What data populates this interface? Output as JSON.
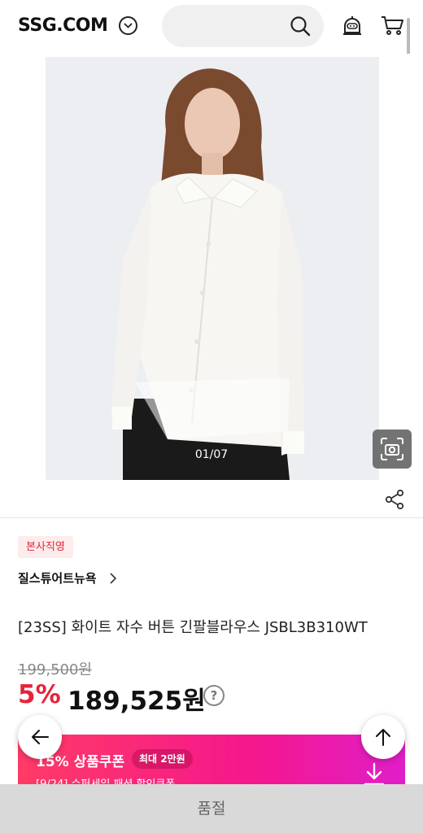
{
  "header": {
    "logo": "SSG.COM",
    "search_placeholder": ""
  },
  "gallery": {
    "counter": "01/07"
  },
  "product": {
    "badge": "본사직영",
    "brand": "질스튜어트뉴욕",
    "title": "[23SS] 화이트 자수 버튼 긴팔블라우스 JSBL3B310WT",
    "original_price": "199,500원",
    "discount": "5%",
    "sale_price": "189,525원",
    "help_symbol": "?"
  },
  "coupon": {
    "title": "15% 상품쿠폰",
    "max_label": "최대 2만원",
    "subtitle": "[9/24] 슈퍼세일 패션 할인쿠폰"
  },
  "bottom_bar": {
    "label": "품절"
  },
  "colors": {
    "accent_red": "#e5243b",
    "coupon_start": "#ff3b66",
    "coupon_end": "#e01ec8",
    "bottom_bar_bg": "#d9d9d9"
  },
  "icons": [
    "chevron-down-icon",
    "search-icon",
    "chatbot-icon",
    "cart-icon",
    "back-arrow-icon",
    "image-search-icon",
    "share-icon",
    "chevron-right-icon",
    "help-icon",
    "download-icon",
    "arrow-left-icon",
    "arrow-up-icon"
  ]
}
